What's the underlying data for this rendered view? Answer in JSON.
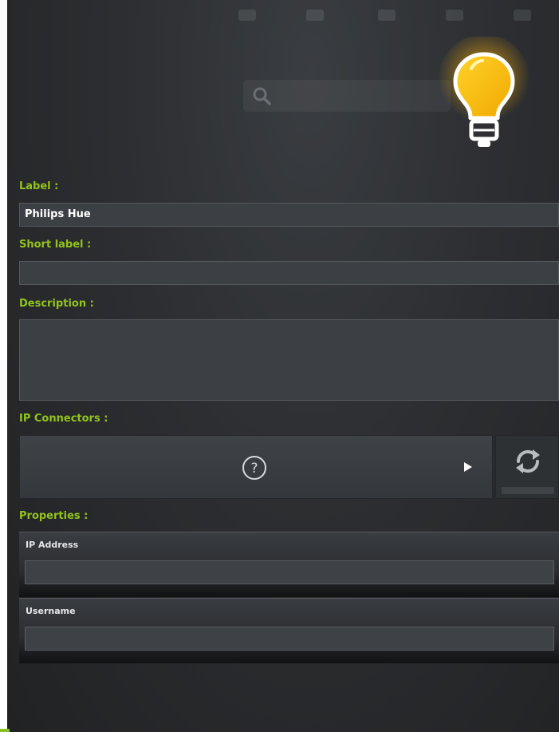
{
  "form": {
    "label_caption": "Label :",
    "label_value": "Philips Hue",
    "short_label_caption": "Short label :",
    "short_label_value": "",
    "description_caption": "Description :",
    "description_value": "",
    "ip_connectors_caption": "IP Connectors :",
    "properties_caption": "Properties :"
  },
  "properties": [
    {
      "title": "IP Address",
      "value": ""
    },
    {
      "title": "Username",
      "value": ""
    }
  ],
  "icons": {
    "device": "lightbulb-icon",
    "connector": "question-icon",
    "expand": "play-icon",
    "refresh": "refresh-icon",
    "search": "search-icon"
  },
  "colors": {
    "accent": "#93c31c",
    "bulb": "#f5b800",
    "background": "#2c2e31"
  }
}
